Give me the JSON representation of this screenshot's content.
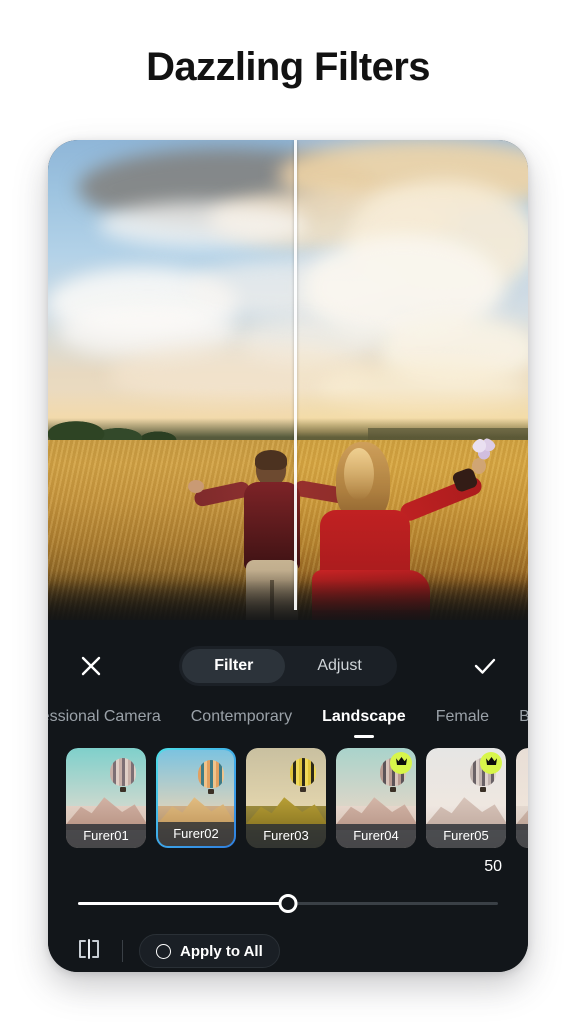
{
  "page": {
    "title": "Dazzling Filters"
  },
  "toolbar": {
    "close_icon": "close-icon",
    "confirm_icon": "check-icon",
    "segments": [
      {
        "label": "Filter",
        "active": true
      },
      {
        "label": "Adjust",
        "active": false
      }
    ]
  },
  "categories": [
    {
      "label": "rofessional Camera",
      "active": false,
      "clipped": true
    },
    {
      "label": "Contemporary",
      "active": false
    },
    {
      "label": "Landscape",
      "active": true
    },
    {
      "label": "Female",
      "active": false
    },
    {
      "label": "Ba",
      "active": false,
      "clipped": true
    }
  ],
  "filters": [
    {
      "label": "Furer01",
      "selected": false,
      "premium": false,
      "sky": "#7fd0cb",
      "ground": "#e2cfc3",
      "mountain": "#d7b9ab",
      "balloon_a": "#c8b0a8",
      "balloon_b": "#7d6f74",
      "balloon_c": "#e0cfc6"
    },
    {
      "label": "Furer02",
      "selected": true,
      "premium": false,
      "sky": "#7cc3e0",
      "ground": "#cfae86",
      "mountain": "#e0b77e",
      "balloon_a": "#e2a060",
      "balloon_b": "#3f7c86",
      "balloon_c": "#efc48c"
    },
    {
      "label": "Furer03",
      "selected": false,
      "premium": false,
      "sky": "#c9c0a0",
      "ground": "#9a8a3c",
      "mountain": "#c2a83a",
      "balloon_a": "#e0c43c",
      "balloon_b": "#2e2a18",
      "balloon_c": "#f0d95a"
    },
    {
      "label": "Furer04",
      "selected": false,
      "premium": true,
      "sky": "#a9d3cb",
      "ground": "#e6d6cb",
      "mountain": "#d9bdaf",
      "balloon_a": "#b89a90",
      "balloon_b": "#5d5458",
      "balloon_c": "#d9c4ba"
    },
    {
      "label": "Furer05",
      "selected": false,
      "premium": true,
      "sky": "#e6e6e4",
      "ground": "#eee6e0",
      "mountain": "#ddcac0",
      "balloon_a": "#c0b2ad",
      "balloon_b": "#6a6266",
      "balloon_c": "#ded2cc"
    },
    {
      "label": "",
      "selected": false,
      "premium": false,
      "sky": "#e8ded6",
      "ground": "#e4d8cf",
      "mountain": "#d8c3b6",
      "balloon_a": "#c9b8ae",
      "balloon_b": "#74696c",
      "balloon_c": "#e0d2c9"
    }
  ],
  "slider": {
    "value": "50",
    "percent": 50
  },
  "bottom": {
    "compare_icon": "compare-split-icon",
    "apply_to_all_label": "Apply to All"
  },
  "colors": {
    "accent_selected": "#3da6e8",
    "premium_badge": "#d8f64a",
    "panel_bg": "#12161a",
    "page_bg": "#ffffff"
  }
}
